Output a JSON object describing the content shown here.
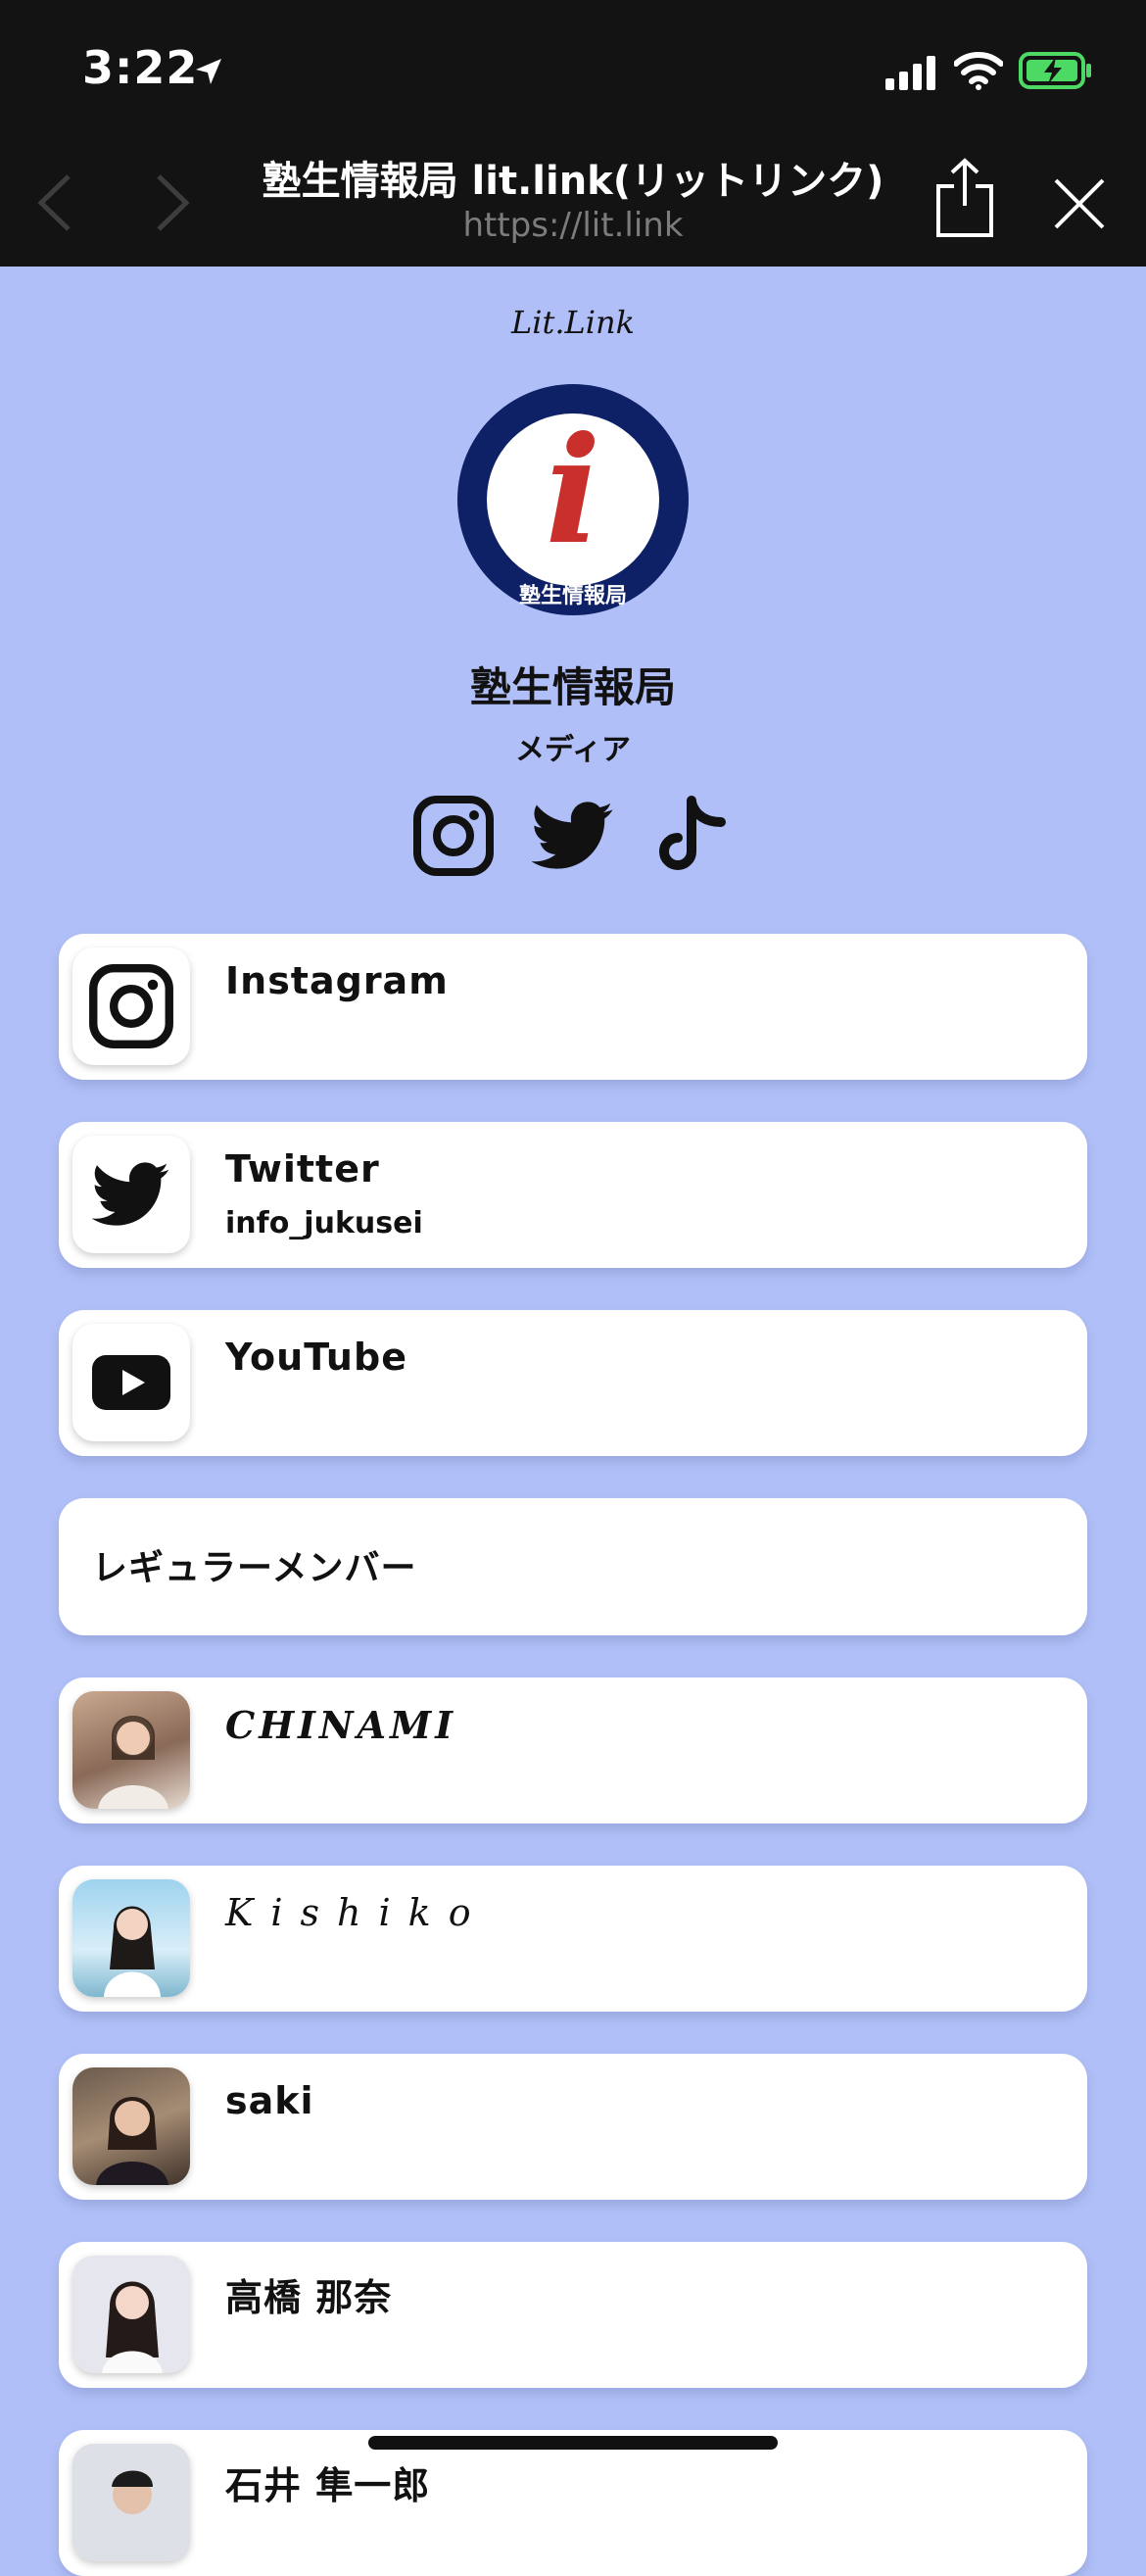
{
  "status_bar": {
    "time": "3:22"
  },
  "browser": {
    "title": "塾生情報局 lit.link(リットリンク)",
    "url": "https://lit.link"
  },
  "brand": {
    "logo_text": "Lit.Link"
  },
  "profile": {
    "avatar_letter": "i",
    "avatar_text": "塾生情報局",
    "name": "塾生情報局",
    "category": "メディア"
  },
  "social_icons": [
    "instagram-icon",
    "twitter-icon",
    "tiktok-icon"
  ],
  "links": [
    {
      "title": "Instagram",
      "subtitle": ""
    },
    {
      "title": "Twitter",
      "subtitle": "info_jukusei"
    },
    {
      "title": "YouTube",
      "subtitle": ""
    }
  ],
  "section_heading": "レギュラーメンバー",
  "members": [
    {
      "title": "CHINAMI"
    },
    {
      "title": "Kishiko"
    },
    {
      "title": "saki"
    },
    {
      "title": "高橋 那奈"
    },
    {
      "title": "石井 隼一郎"
    }
  ],
  "colors": {
    "background": "#b0bff7",
    "topbar": "#131313",
    "avatar_ring": "#0f2166",
    "avatar_letter": "#c9302c",
    "battery": "#4cd964"
  }
}
